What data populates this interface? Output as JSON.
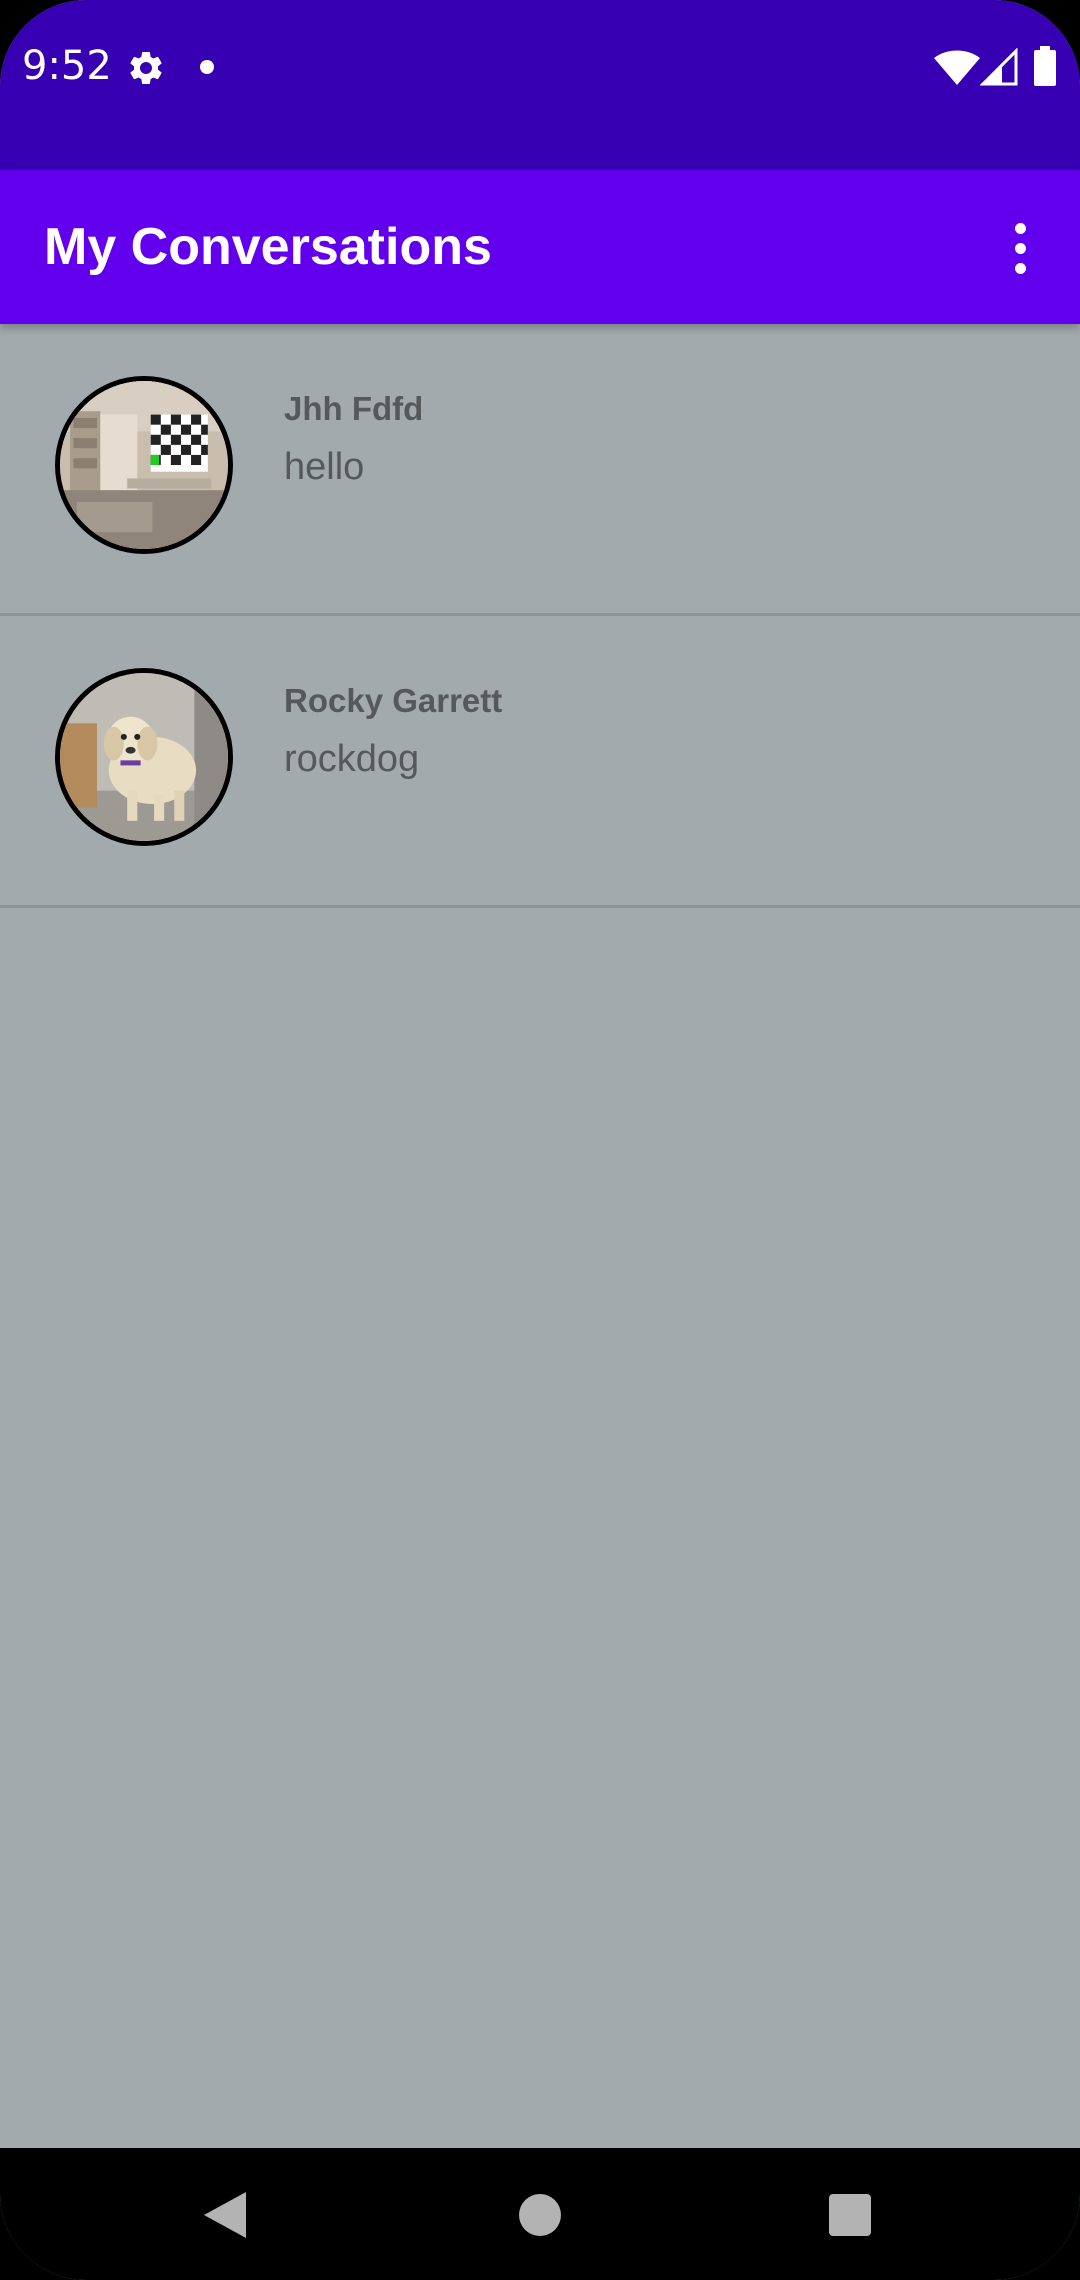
{
  "status_bar": {
    "time": "9:52",
    "icons": [
      "gear-icon",
      "notification-dot-icon",
      "wifi-icon",
      "cell-signal-icon",
      "battery-icon"
    ]
  },
  "app_bar": {
    "title": "My Conversations",
    "overflow_icon": "more-vert-icon"
  },
  "conversations": [
    {
      "name": "Jhh Fdfd",
      "message": "hello",
      "avatar": "room-photo"
    },
    {
      "name": "Rocky Garrett",
      "message": "rockdog",
      "avatar": "dog-photo"
    }
  ],
  "nav_bar": {
    "icons": [
      "back-icon",
      "home-icon",
      "recents-icon"
    ]
  },
  "colors": {
    "status_bar": "#3700b3",
    "app_bar": "#6200ee",
    "background": "#a2aaad",
    "text": "#55595b",
    "nav_bar": "#000000"
  }
}
